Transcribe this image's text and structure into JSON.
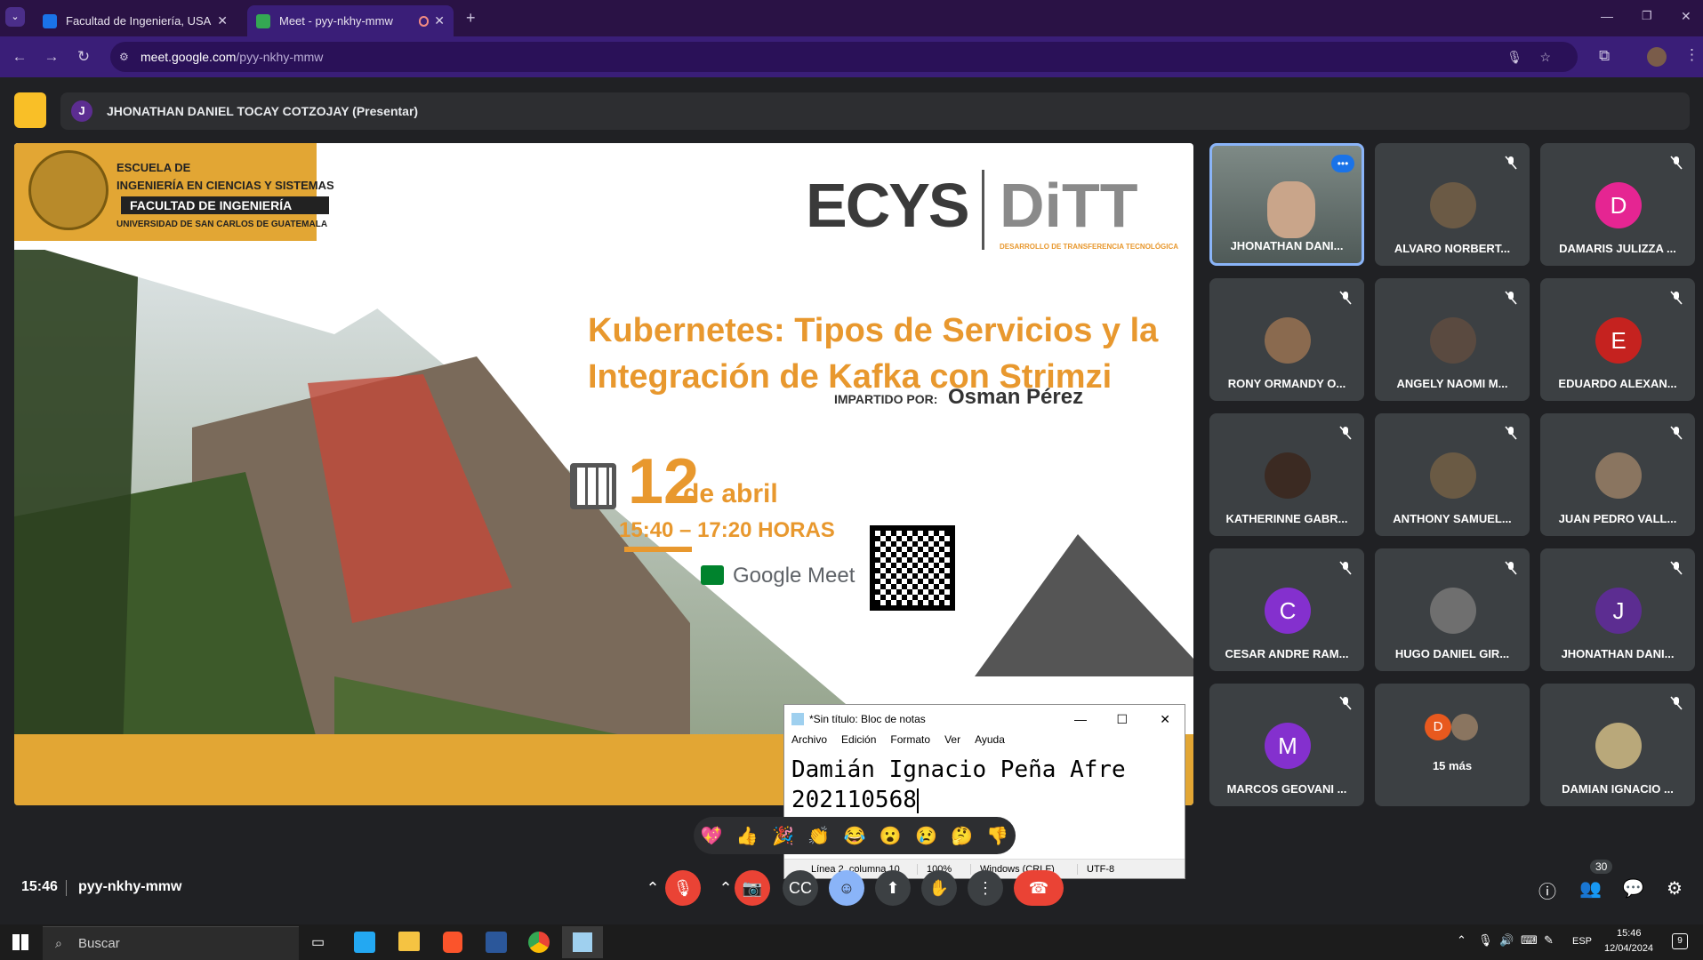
{
  "browser": {
    "tabs": [
      {
        "title": "Facultad de Ingeniería, USAC -",
        "active": false
      },
      {
        "title": "Meet - pyy-nkhy-mmw",
        "active": true
      }
    ],
    "url_host": "meet.google.com",
    "url_path": "/pyy-nkhy-mmw"
  },
  "presenter": {
    "initial": "J",
    "label": "JHONATHAN DANIEL TOCAY COTZOJAY (Presentar)"
  },
  "slide": {
    "school_line1": "ESCUELA DE",
    "school_line2": "INGENIERÍA EN CIENCIAS Y SISTEMAS",
    "school_line3": "FACULTAD DE INGENIERÍA",
    "school_line4": "UNIVERSIDAD DE SAN CARLOS DE GUATEMALA",
    "logo_ecys": "ECYS",
    "logo_ditt": "DiTT",
    "logo_ditt_sub": "DESARROLLO DE TRANSFERENCIA TECNOLÓGICA",
    "title": "Kubernetes: Tipos de Servicios y la Integración de Kafka con Strimzi",
    "impartido": "IMPARTIDO POR:",
    "speaker": "Osman Pérez",
    "date_day": "12",
    "date_month": "de abril",
    "time": "15:40 – 17:20 HORAS",
    "platform": "Google Meet"
  },
  "notepad": {
    "title": "*Sin título: Bloc de notas",
    "menu": [
      "Archivo",
      "Edición",
      "Formato",
      "Ver",
      "Ayuda"
    ],
    "line1": "Damián Ignacio Peña Afre",
    "line2": "202110568",
    "status": [
      "Línea 2, columna 10",
      "100%",
      "Windows (CRLF)",
      "UTF-8"
    ]
  },
  "participants": [
    {
      "name": "JHONATHAN DANI...",
      "initial": "",
      "color": "",
      "video": true
    },
    {
      "name": "ALVARO NORBERT...",
      "initial": "",
      "color": "#6b5a45"
    },
    {
      "name": "DAMARIS JULIZZA ...",
      "initial": "D",
      "color": "#e52592"
    },
    {
      "name": "RONY ORMANDY O...",
      "initial": "",
      "color": "#8a6a4f"
    },
    {
      "name": "ANGELY NAOMI M...",
      "initial": "",
      "color": "#5a4a40"
    },
    {
      "name": "EDUARDO ALEXAN...",
      "initial": "E",
      "color": "#c5221f"
    },
    {
      "name": "KATHERINNE GABR...",
      "initial": "",
      "color": "#3b2a22"
    },
    {
      "name": "ANTHONY SAMUEL...",
      "initial": "",
      "color": "#6a5a44"
    },
    {
      "name": "JUAN PEDRO VALL...",
      "initial": "",
      "color": "#8a7560"
    },
    {
      "name": "CESAR ANDRE RAM...",
      "initial": "C",
      "color": "#8430ce"
    },
    {
      "name": "HUGO DANIEL GIR...",
      "initial": "",
      "color": "#6f6f6f"
    },
    {
      "name": "JHONATHAN DANI...",
      "initial": "J",
      "color": "#5c2d91"
    },
    {
      "name": "MARCOS GEOVANI ...",
      "initial": "M",
      "color": "#8430ce"
    },
    {
      "name": "15 más",
      "initial": "D",
      "color": "#e8591e"
    },
    {
      "name": "DAMIAN IGNACIO ...",
      "initial": "",
      "color": "#b9a87a"
    }
  ],
  "bottom": {
    "time": "15:46",
    "meeting_code": "pyy-nkhy-mmw",
    "participant_count": "30"
  },
  "taskbar": {
    "search": "Buscar",
    "lang": "ESP",
    "clock_time": "15:46",
    "clock_date": "12/04/2024",
    "notif_count": "9"
  },
  "colors": {
    "accent_gold": "#e2a634",
    "title_orange": "#e8982e",
    "meet_red": "#ea4335",
    "chrome_purple": "#3a1e78"
  }
}
